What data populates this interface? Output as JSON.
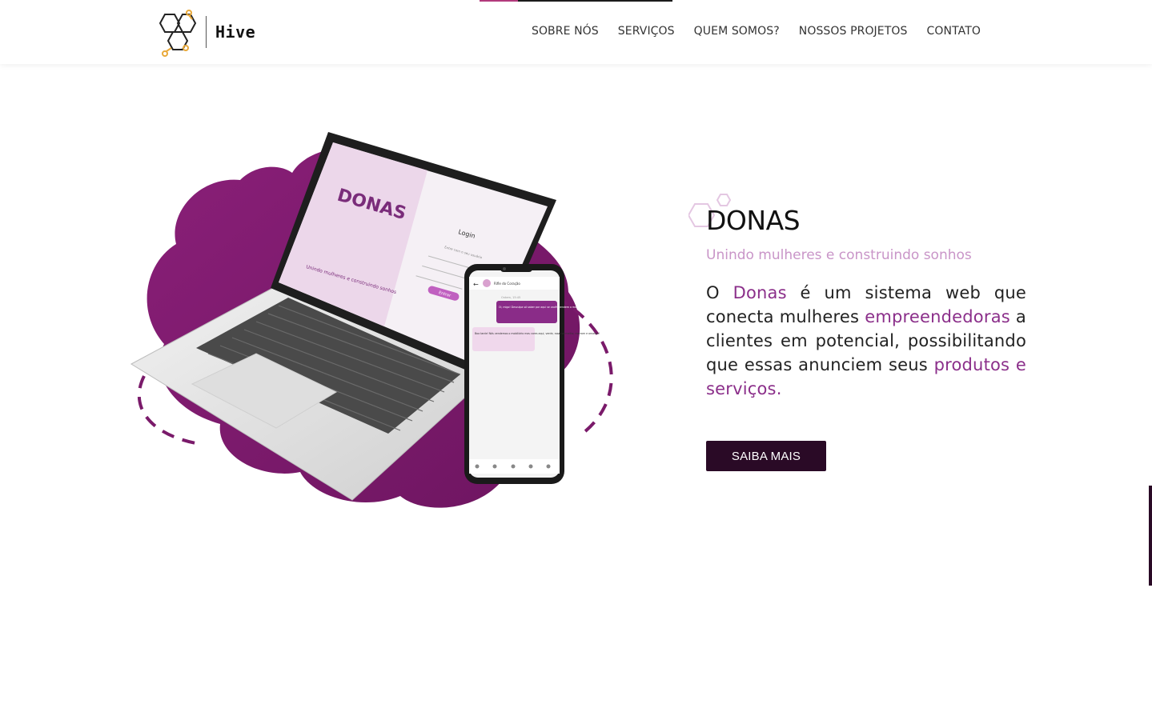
{
  "brand": {
    "name": "Hive",
    "logo_icon": "honeycomb-logo-icon"
  },
  "nav": {
    "items": [
      "SOBRE NÓS",
      "SERVIÇOS",
      "QUEM SOMOS?",
      "NOSSOS PROJETOS",
      "CONTATO"
    ]
  },
  "hero": {
    "title": "DONAS",
    "subtitle": "Unindo mulheres e construindo sonhos",
    "description": {
      "p1": "O ",
      "h1": "Donas",
      "p2": " é um sistema web que conecta mulheres ",
      "h2": "empreendedoras",
      "p3": " a clientes em potencial, possibilitando que essas anunciem seus ",
      "h3": "produtos e serviços."
    },
    "cta_label": "SAIBA MAIS"
  },
  "mockup": {
    "laptop_brand": "DONAS",
    "laptop_tagline": "Unindo mulheres e construindo sonhos",
    "login_title": "Login",
    "login_subtitle": "Entre com o seu usuário",
    "login_button": "Entrar",
    "phone_header": "Rifle do Coração",
    "chat_date": "Ontem, 15:45",
    "chat_msg_1": "Oi, migo! Desculpa só saber por aqui se vocês vendem o mobília.",
    "chat_msg_2": "Boa tarde! Nós vendemos o mobiliário mas cores aqui, verde, rosa, vermelho, marrom e amarelo!"
  },
  "colors": {
    "accent": "#8b2f8a",
    "subtitle": "#c995c8",
    "button_bg": "#2a0a26",
    "blob": "#7a1a6a"
  }
}
